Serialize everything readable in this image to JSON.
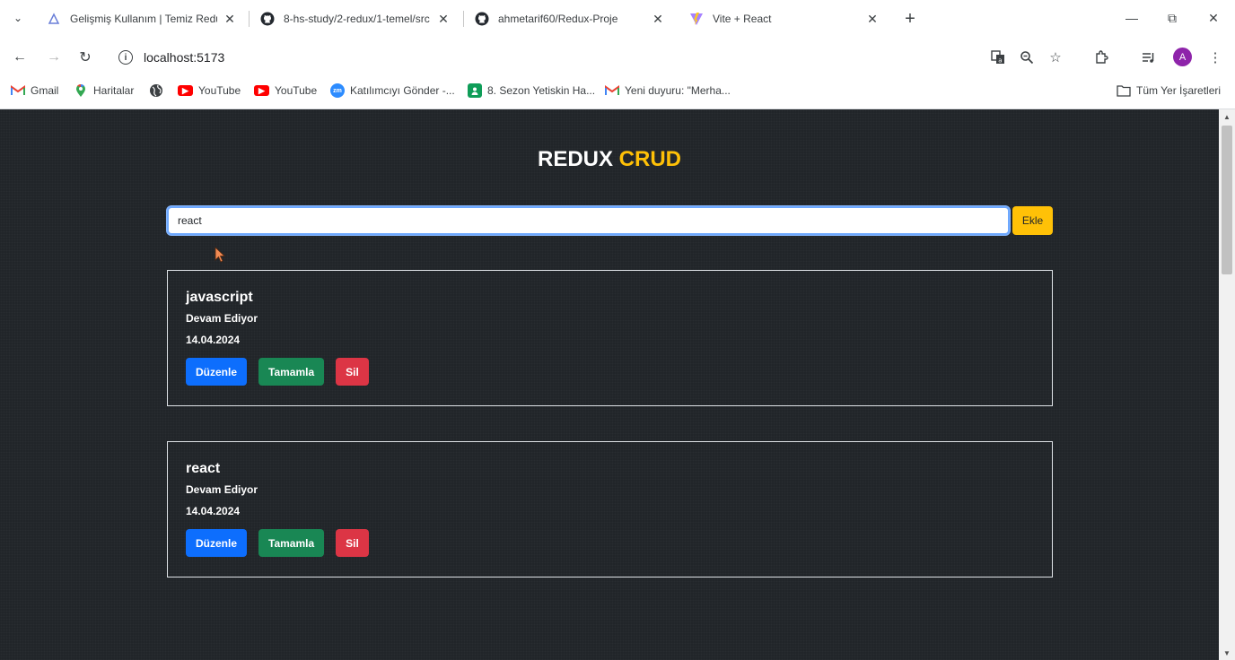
{
  "browser": {
    "tabs": [
      {
        "title": "Gelişmiş Kullanım | Temiz Redux",
        "favicon": "redux-docs-icon"
      },
      {
        "title": "8-hs-study/2-redux/1-temel/src",
        "favicon": "github-icon"
      },
      {
        "title": "ahmetarif60/Redux-Proje",
        "favicon": "github-icon"
      },
      {
        "title": "Vite + React",
        "favicon": "vite-icon"
      }
    ],
    "url": "localhost:5173",
    "avatar_letter": "A",
    "bookmarks": [
      {
        "label": "Gmail",
        "icon": "gmail-icon"
      },
      {
        "label": "Haritalar",
        "icon": "maps-icon"
      },
      {
        "label": "",
        "icon": "globe-icon"
      },
      {
        "label": "YouTube",
        "icon": "youtube-icon"
      },
      {
        "label": "YouTube",
        "icon": "youtube-icon"
      },
      {
        "label": "Katılımcıyı Gönder -...",
        "icon": "zoom-icon"
      },
      {
        "label": "8. Sezon Yetiskin Ha...",
        "icon": "classroom-icon"
      },
      {
        "label": "Yeni duyuru: \"Merha...",
        "icon": "gmail-icon"
      }
    ],
    "all_bookmarks": "Tüm Yer İşaretleri"
  },
  "app": {
    "title_main": "REDUX",
    "title_accent": "CRUD",
    "accent_color": "#ffc107",
    "input_value": "react",
    "add_button": "Ekle",
    "todos": [
      {
        "title": "javascript",
        "status": "Devam Ediyor",
        "date": "14.04.2024"
      },
      {
        "title": "react",
        "status": "Devam Ediyor",
        "date": "14.04.2024"
      }
    ],
    "actions": {
      "edit": "Düzenle",
      "complete": "Tamamla",
      "delete": "Sil"
    }
  }
}
